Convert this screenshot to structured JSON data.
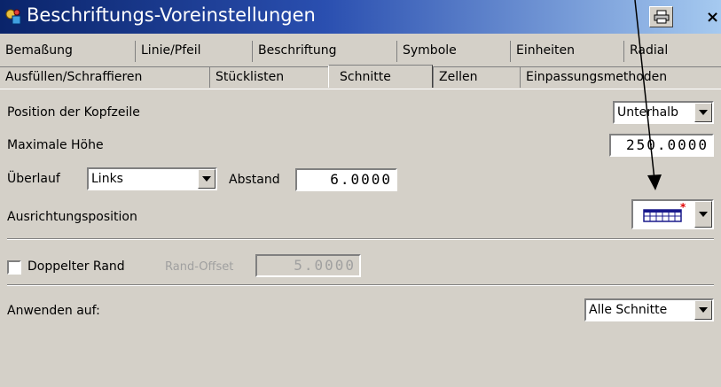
{
  "window": {
    "title": "Beschriftungs-Voreinstellungen",
    "close_label": "×"
  },
  "tabs": {
    "row1": [
      "Bemaßung",
      "Linie/Pfeil",
      "Beschriftung",
      "Symbole",
      "Einheiten",
      "Radial"
    ],
    "row2": [
      "Ausfüllen/Schraffieren",
      "Stücklisten",
      "Schnitte",
      "Zellen",
      "Einpassungsmethoden"
    ],
    "active": "Schnitte"
  },
  "form": {
    "kopfzeile_label": "Position der Kopfzeile",
    "kopfzeile_value": "Unterhalb",
    "max_hoehe_label": "Maximale Höhe",
    "max_hoehe_value": "250.0000",
    "ueberlauf_label": "Überlauf",
    "ueberlauf_value": "Links",
    "abstand_label": "Abstand",
    "abstand_value": "6.0000",
    "ausrichtung_label": "Ausrichtungsposition",
    "doppelter_rand_label": "Doppelter Rand",
    "doppelter_rand_checked": false,
    "rand_offset_label": "Rand-Offset",
    "rand_offset_value": "5.0000",
    "anwenden_label": "Anwenden auf:",
    "anwenden_value": "Alle Schnitte"
  },
  "icons": {
    "app": "app-tools-icon",
    "print": "printer-icon",
    "table": "table-grid-icon"
  },
  "colors": {
    "titlebar_start": "#0a246a",
    "titlebar_end": "#a6caf0",
    "dialog_bg": "#d4d0c8",
    "table_icon": "#1a1a8c",
    "table_star": "#e00000"
  }
}
